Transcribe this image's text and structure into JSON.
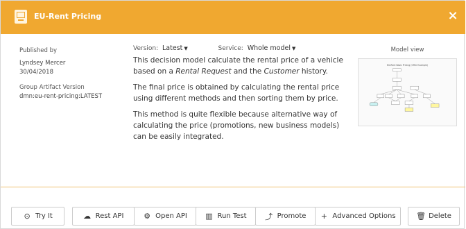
{
  "window": {
    "title": "EU-Rent Pricing",
    "close_label": "×"
  },
  "meta": {
    "published_by_label": "Published by",
    "author": "Lyndsey Mercer",
    "date": "30/04/2018",
    "group_artifact_label": "Group Artifact Version",
    "group_artifact_value": "dmn:eu-rent-pricing:LATEST"
  },
  "selectors": {
    "version_label": "Version:",
    "version_value": "Latest",
    "service_label": "Service:",
    "service_value": "Whole model"
  },
  "description": {
    "p1_a": "This decision model calculate the rental price of a vehicle based on a ",
    "p1_em1": "Rental Request",
    "p1_b": " and the ",
    "p1_em2": "Customer",
    "p1_c": " history.",
    "p2": "The final price is obtained by calculating the rental price using different methods and then sorting them by price.",
    "p3": "This method is quite flexible because alternative way of calculating the price (promotions, new business models) can be easily integrated."
  },
  "model_view": {
    "label": "Model view",
    "diagram_title": "EU-Rent Basic Pricing (Offer Example)",
    "colors": {
      "node": "#ffffff",
      "input": "#c8f0f0",
      "knowledge": "#fff7a0",
      "edge": "#888888"
    }
  },
  "actions": [
    {
      "label": "Try It",
      "icon": "play-circle-icon"
    },
    {
      "label": "Rest API",
      "icon": "cloud-upload-icon"
    },
    {
      "label": "Open API",
      "icon": "cogs-icon"
    },
    {
      "label": "Run Test",
      "icon": "table-icon"
    },
    {
      "label": "Promote",
      "icon": "arrow-up-icon"
    },
    {
      "label": "Advanced Options",
      "icon": "plus-icon"
    },
    {
      "label": "Delete",
      "icon": "trash-icon"
    }
  ],
  "colors": {
    "accent": "#f0a830",
    "divider": "#f0c070"
  }
}
